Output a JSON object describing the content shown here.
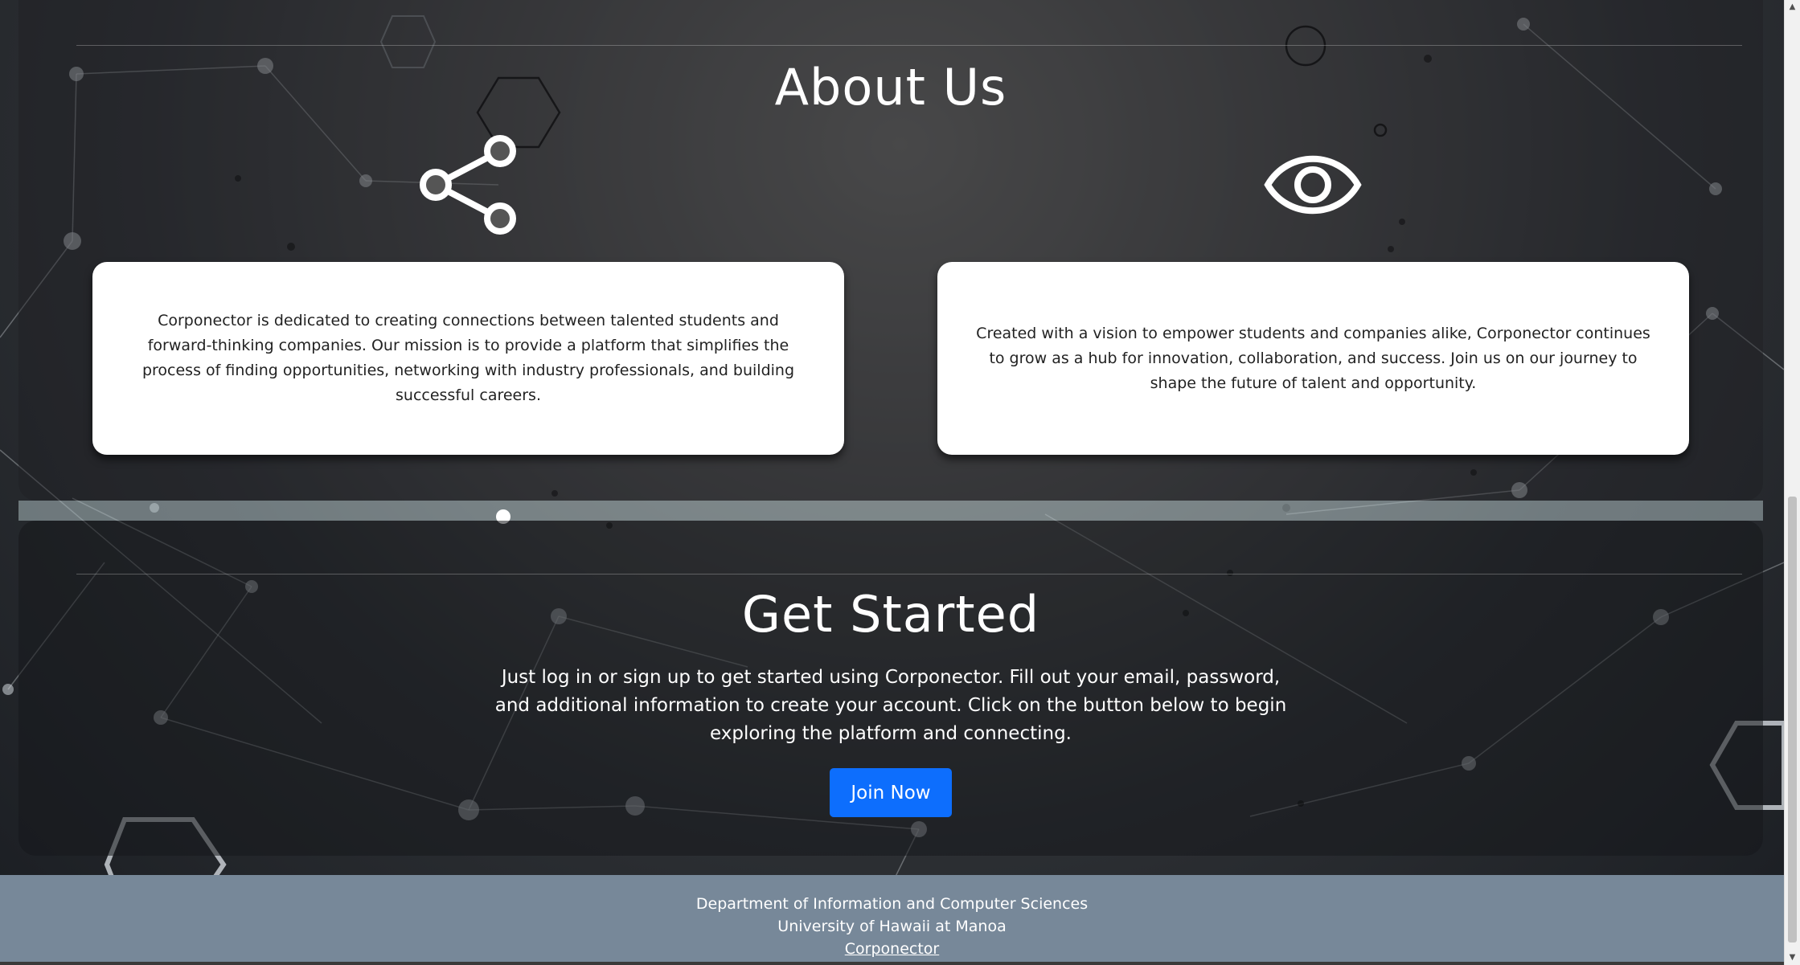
{
  "about": {
    "title": "About Us",
    "icons": [
      "share-icon",
      "eye-icon"
    ],
    "mission_text": "Corponector is dedicated to creating connections between talented students and forward-thinking companies. Our mission is to provide a platform that simplifies the process of finding opportunities, networking with industry professionals, and building successful careers.",
    "vision_text": "Created with a vision to empower students and companies alike, Corponector continues to grow as a hub for innovation, collaboration, and success. Join us on our journey to shape the future of talent and opportunity."
  },
  "get_started": {
    "title": "Get Started",
    "description": "Just log in or sign up to get started using Corponector. Fill out your email, password, and additional information to create your account. Click on the button below to begin exploring the platform and connecting.",
    "button_label": "Join Now"
  },
  "footer": {
    "line1": "Department of Information and Computer Sciences",
    "line2": "University of Hawaii at Manoa",
    "link_label": "Corponector"
  },
  "colors": {
    "accent": "#0d6efd",
    "footer_bg": "#778899",
    "card_bg": "#ffffff"
  }
}
